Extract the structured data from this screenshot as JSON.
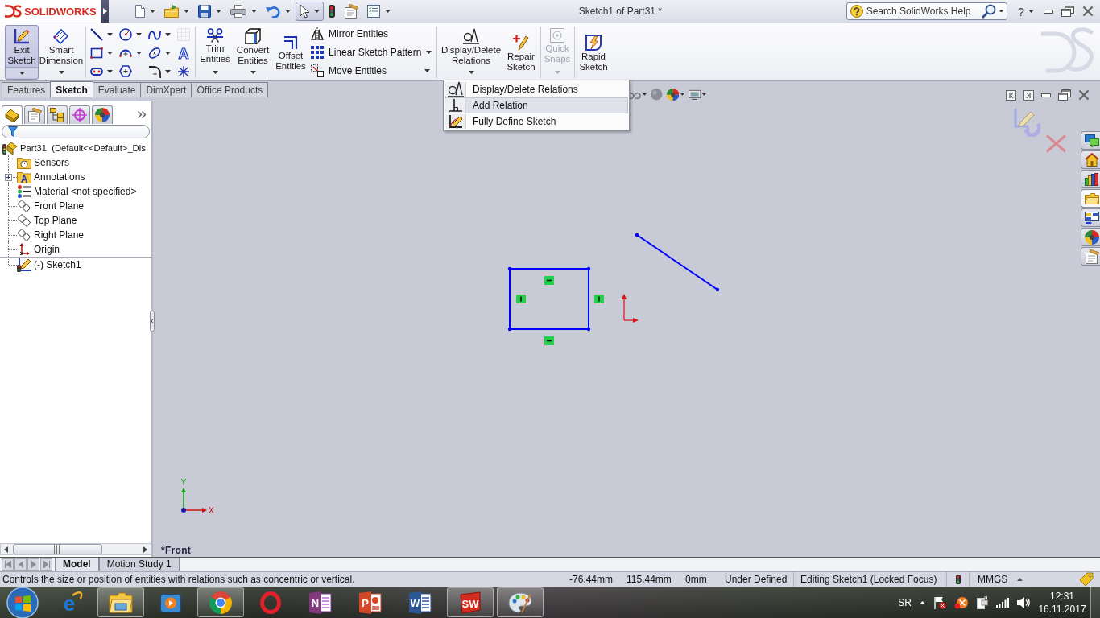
{
  "title_bar": {
    "logo": "SOLIDWORKS",
    "title": "Sketch1 of Part31 *",
    "search": {
      "placeholder": "Search SolidWorks Help"
    },
    "help": "?"
  },
  "quick_access": [
    {
      "kind": "new",
      "menu": true,
      "pressed": false
    },
    {
      "kind": "open",
      "menu": true,
      "pressed": false
    },
    {
      "kind": "save",
      "menu": true,
      "pressed": false
    },
    {
      "kind": "print",
      "menu": true,
      "pressed": false
    },
    {
      "kind": "undo",
      "menu": true,
      "pressed": false
    },
    {
      "kind": "select",
      "menu": true,
      "pressed": true
    },
    {
      "kind": "rebuild",
      "menu": false,
      "pressed": false
    },
    {
      "kind": "properties",
      "menu": false,
      "pressed": false
    },
    {
      "kind": "options",
      "menu": true,
      "pressed": false
    }
  ],
  "command_manager": {
    "sketch_commands": [
      {
        "kind": "exit_sketch",
        "label": "Exit Sketch",
        "menu": true,
        "pressed": true
      },
      {
        "kind": "smart_dimension",
        "label": "Smart Dimension",
        "menu": true,
        "pressed": false
      }
    ],
    "sketch_tools": [
      {
        "kind": "line",
        "menu": true,
        "disabled": false
      },
      {
        "kind": "circle",
        "menu": true,
        "disabled": false
      },
      {
        "kind": "spline",
        "menu": true,
        "disabled": false
      },
      {
        "kind": "construction_grid",
        "menu": false,
        "disabled": true
      },
      {
        "kind": "rectangle",
        "menu": true,
        "disabled": false
      },
      {
        "kind": "arc",
        "menu": true,
        "disabled": false
      },
      {
        "kind": "ellipse",
        "menu": true,
        "disabled": false
      },
      {
        "kind": "text",
        "glyph": "A",
        "menu": false,
        "disabled": false
      },
      {
        "kind": "slot",
        "menu": true,
        "disabled": false
      },
      {
        "kind": "polygon",
        "menu": false,
        "disabled": false
      },
      {
        "kind": "fillet",
        "menu": true,
        "disabled": false
      },
      {
        "kind": "point",
        "menu": false,
        "disabled": false
      }
    ],
    "edit_commands": [
      {
        "kind": "trim",
        "label": "Trim Entities",
        "menu": true
      },
      {
        "kind": "convert",
        "label": "Convert Entities",
        "menu": true
      },
      {
        "kind": "offset",
        "label": "Offset Entities",
        "menu": false
      }
    ],
    "edit_list": [
      {
        "kind": "mirror",
        "label": "Mirror Entities",
        "menu": false
      },
      {
        "kind": "linear_pattern",
        "label": "Linear Sketch Pattern",
        "menu": true
      },
      {
        "kind": "move",
        "label": "Move Entities",
        "menu": true
      }
    ],
    "relation_commands": [
      {
        "kind": "relations",
        "label": "Display/Delete Relations",
        "menu": true,
        "disabled": false
      },
      {
        "kind": "repair",
        "label": "Repair Sketch",
        "menu": false,
        "disabled": false
      },
      {
        "kind": "quick_snaps",
        "label": "Quick Snaps",
        "menu": true,
        "disabled": true
      },
      {
        "kind": "rapid_sketch",
        "label": "Rapid Sketch",
        "menu": false,
        "disabled": false
      }
    ]
  },
  "tabs": [
    {
      "label": "Features",
      "selected": false
    },
    {
      "label": "Sketch",
      "selected": true
    },
    {
      "label": "Evaluate",
      "selected": false
    },
    {
      "label": "DimXpert",
      "selected": false
    },
    {
      "label": "Office Products",
      "selected": false
    }
  ],
  "relations_menu": [
    {
      "kind": "relations",
      "label": "Display/Delete Relations",
      "selected": false
    },
    {
      "kind": "add_relation",
      "label": "Add Relation",
      "selected": true
    },
    {
      "kind": "fully_define",
      "label": "Fully Define Sketch",
      "selected": false
    }
  ],
  "heads_up_toolbar": [
    {
      "kind": "view_settings",
      "menu": true
    },
    {
      "kind": "display_style",
      "menu": false
    },
    {
      "kind": "appearance",
      "menu": true
    },
    {
      "kind": "scene",
      "menu": true
    }
  ],
  "feature_manager": {
    "tabs": [
      {
        "kind": "features",
        "selected": true
      },
      {
        "kind": "properties",
        "selected": false
      },
      {
        "kind": "configurations",
        "selected": false
      },
      {
        "kind": "dimxpert",
        "selected": false
      },
      {
        "kind": "display",
        "selected": false
      }
    ],
    "tree": {
      "kind": "part",
      "label": "Part31  (Default<<Default>_Dis",
      "children": [
        {
          "kind": "sensors",
          "label": "Sensors",
          "expandable": false,
          "divider_above": false
        },
        {
          "kind": "annotations",
          "glyph": "A",
          "label": "Annotations",
          "expandable": true,
          "divider_above": false
        },
        {
          "kind": "material",
          "label": "Material <not specified>",
          "expandable": false,
          "divider_above": false
        },
        {
          "kind": "plane",
          "label": "Front Plane",
          "expandable": false,
          "divider_above": false
        },
        {
          "kind": "plane",
          "label": "Top Plane",
          "expandable": false,
          "divider_above": false
        },
        {
          "kind": "plane",
          "label": "Right Plane",
          "expandable": false,
          "divider_above": false
        },
        {
          "kind": "origin",
          "label": "Origin",
          "expandable": false,
          "divider_above": false
        },
        {
          "kind": "sketch",
          "label": "(-) Sketch1",
          "expandable": false,
          "divider_above": true
        }
      ]
    }
  },
  "graphics": {
    "view_label": "*Front",
    "triad": {
      "y_label": "Y",
      "x_label": "X"
    }
  },
  "task_pane": [
    {
      "kind": "resources",
      "selected": false
    },
    {
      "kind": "home",
      "selected": false
    },
    {
      "kind": "library",
      "selected": false
    },
    {
      "kind": "file_explorer",
      "selected": true
    },
    {
      "kind": "view_palette",
      "selected": false
    },
    {
      "kind": "appearances",
      "selected": false
    },
    {
      "kind": "custom_properties",
      "selected": false
    }
  ],
  "bottom_tabs": [
    {
      "label": "Model",
      "selected": true
    },
    {
      "label": "Motion Study 1",
      "selected": false
    }
  ],
  "status_bar": {
    "message": "Controls the size or position of entities with relations such as concentric or vertical.",
    "x": "-76.44mm",
    "y": "115.44mm",
    "z": "0mm",
    "sketch_state": "Under Defined",
    "mode": "Editing Sketch1 (Locked Focus)",
    "units": "MMGS"
  },
  "taskbar": {
    "apps": [
      {
        "kind": "ie",
        "glyph": "e",
        "active": false
      },
      {
        "kind": "explorer",
        "active": true
      },
      {
        "kind": "media_player",
        "active": false
      },
      {
        "kind": "chrome",
        "active": true
      },
      {
        "kind": "opera",
        "active": false
      },
      {
        "kind": "onenote",
        "glyph": "N",
        "active": false
      },
      {
        "kind": "powerpoint",
        "glyph": "P",
        "active": false
      },
      {
        "kind": "word",
        "glyph": "W",
        "active": false
      },
      {
        "kind": "solidworks",
        "glyph": "SW",
        "active": true
      },
      {
        "kind": "paint",
        "active": true
      }
    ],
    "language": "SR",
    "time": "12:31",
    "date": "16.11.2017"
  }
}
